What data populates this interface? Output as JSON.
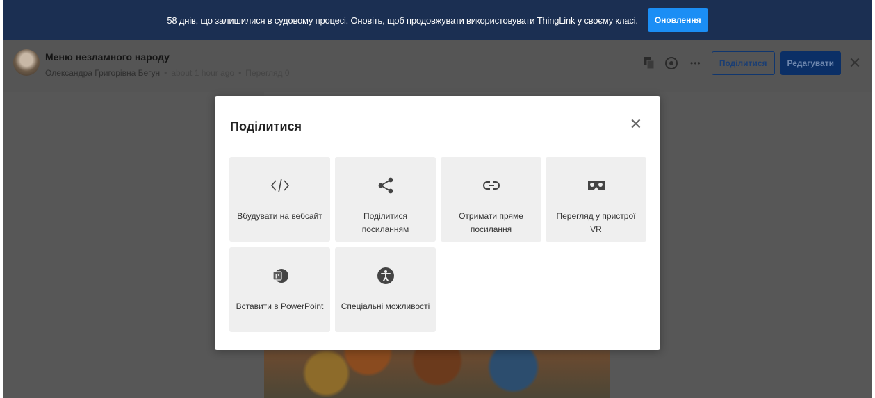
{
  "banner": {
    "message": "58 днів, що залишилися в судовому процесі. Оновіть, щоб продовжувати використовувати ThingLink у своєму класі.",
    "upgrade_label": "Оновлення"
  },
  "header": {
    "title": "Меню незламного народу",
    "author": "Олександра Григорівна Бегун",
    "sep1": "•",
    "time": "about 1 hour ago",
    "sep2": "•",
    "views": "Перегляд 0",
    "share_label": "Поділитися",
    "edit_label": "Редагувати",
    "close_glyph": "✕",
    "more_glyph": "•••"
  },
  "modal": {
    "title": "Поділитися",
    "close_glyph": "✕",
    "tiles": [
      {
        "label": "Вбудувати на вебсайт",
        "icon": "code-icon"
      },
      {
        "label": "Поділитися посиланням",
        "icon": "share-icon"
      },
      {
        "label": "Отримати пряме посилання",
        "icon": "link-icon"
      },
      {
        "label": "Перегляд у пристрої VR",
        "icon": "vr-headset-icon"
      },
      {
        "label": "Вставити в PowerPoint",
        "icon": "powerpoint-icon"
      },
      {
        "label": "Спеціальні можливості",
        "icon": "accessibility-icon"
      }
    ]
  },
  "colors": {
    "banner_bg": "#1b2f52",
    "upgrade_btn": "#1b8ef5",
    "overlay": "#575757",
    "tile_bg": "#efefef"
  }
}
